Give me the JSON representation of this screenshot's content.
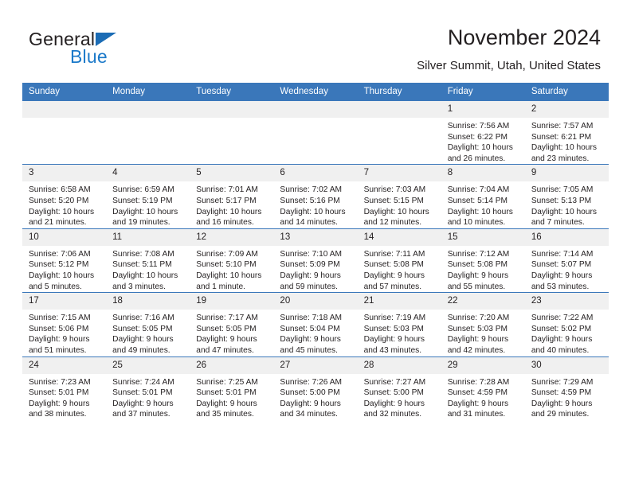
{
  "brand": {
    "name_part1": "General",
    "name_part2": "Blue"
  },
  "header": {
    "title": "November 2024",
    "subtitle": "Silver Summit, Utah, United States"
  },
  "calendar": {
    "weekday_headers": [
      "Sunday",
      "Monday",
      "Tuesday",
      "Wednesday",
      "Thursday",
      "Friday",
      "Saturday"
    ],
    "accent_color": "#3a77ba",
    "daynum_background": "#f0f0f0",
    "weeks": [
      [
        {
          "day": "",
          "empty": true
        },
        {
          "day": "",
          "empty": true
        },
        {
          "day": "",
          "empty": true
        },
        {
          "day": "",
          "empty": true
        },
        {
          "day": "",
          "empty": true
        },
        {
          "day": "1",
          "sunrise": "Sunrise: 7:56 AM",
          "sunset": "Sunset: 6:22 PM",
          "daylight": "Daylight: 10 hours and 26 minutes."
        },
        {
          "day": "2",
          "sunrise": "Sunrise: 7:57 AM",
          "sunset": "Sunset: 6:21 PM",
          "daylight": "Daylight: 10 hours and 23 minutes."
        }
      ],
      [
        {
          "day": "3",
          "sunrise": "Sunrise: 6:58 AM",
          "sunset": "Sunset: 5:20 PM",
          "daylight": "Daylight: 10 hours and 21 minutes."
        },
        {
          "day": "4",
          "sunrise": "Sunrise: 6:59 AM",
          "sunset": "Sunset: 5:19 PM",
          "daylight": "Daylight: 10 hours and 19 minutes."
        },
        {
          "day": "5",
          "sunrise": "Sunrise: 7:01 AM",
          "sunset": "Sunset: 5:17 PM",
          "daylight": "Daylight: 10 hours and 16 minutes."
        },
        {
          "day": "6",
          "sunrise": "Sunrise: 7:02 AM",
          "sunset": "Sunset: 5:16 PM",
          "daylight": "Daylight: 10 hours and 14 minutes."
        },
        {
          "day": "7",
          "sunrise": "Sunrise: 7:03 AM",
          "sunset": "Sunset: 5:15 PM",
          "daylight": "Daylight: 10 hours and 12 minutes."
        },
        {
          "day": "8",
          "sunrise": "Sunrise: 7:04 AM",
          "sunset": "Sunset: 5:14 PM",
          "daylight": "Daylight: 10 hours and 10 minutes."
        },
        {
          "day": "9",
          "sunrise": "Sunrise: 7:05 AM",
          "sunset": "Sunset: 5:13 PM",
          "daylight": "Daylight: 10 hours and 7 minutes."
        }
      ],
      [
        {
          "day": "10",
          "sunrise": "Sunrise: 7:06 AM",
          "sunset": "Sunset: 5:12 PM",
          "daylight": "Daylight: 10 hours and 5 minutes."
        },
        {
          "day": "11",
          "sunrise": "Sunrise: 7:08 AM",
          "sunset": "Sunset: 5:11 PM",
          "daylight": "Daylight: 10 hours and 3 minutes."
        },
        {
          "day": "12",
          "sunrise": "Sunrise: 7:09 AM",
          "sunset": "Sunset: 5:10 PM",
          "daylight": "Daylight: 10 hours and 1 minute."
        },
        {
          "day": "13",
          "sunrise": "Sunrise: 7:10 AM",
          "sunset": "Sunset: 5:09 PM",
          "daylight": "Daylight: 9 hours and 59 minutes."
        },
        {
          "day": "14",
          "sunrise": "Sunrise: 7:11 AM",
          "sunset": "Sunset: 5:08 PM",
          "daylight": "Daylight: 9 hours and 57 minutes."
        },
        {
          "day": "15",
          "sunrise": "Sunrise: 7:12 AM",
          "sunset": "Sunset: 5:08 PM",
          "daylight": "Daylight: 9 hours and 55 minutes."
        },
        {
          "day": "16",
          "sunrise": "Sunrise: 7:14 AM",
          "sunset": "Sunset: 5:07 PM",
          "daylight": "Daylight: 9 hours and 53 minutes."
        }
      ],
      [
        {
          "day": "17",
          "sunrise": "Sunrise: 7:15 AM",
          "sunset": "Sunset: 5:06 PM",
          "daylight": "Daylight: 9 hours and 51 minutes."
        },
        {
          "day": "18",
          "sunrise": "Sunrise: 7:16 AM",
          "sunset": "Sunset: 5:05 PM",
          "daylight": "Daylight: 9 hours and 49 minutes."
        },
        {
          "day": "19",
          "sunrise": "Sunrise: 7:17 AM",
          "sunset": "Sunset: 5:05 PM",
          "daylight": "Daylight: 9 hours and 47 minutes."
        },
        {
          "day": "20",
          "sunrise": "Sunrise: 7:18 AM",
          "sunset": "Sunset: 5:04 PM",
          "daylight": "Daylight: 9 hours and 45 minutes."
        },
        {
          "day": "21",
          "sunrise": "Sunrise: 7:19 AM",
          "sunset": "Sunset: 5:03 PM",
          "daylight": "Daylight: 9 hours and 43 minutes."
        },
        {
          "day": "22",
          "sunrise": "Sunrise: 7:20 AM",
          "sunset": "Sunset: 5:03 PM",
          "daylight": "Daylight: 9 hours and 42 minutes."
        },
        {
          "day": "23",
          "sunrise": "Sunrise: 7:22 AM",
          "sunset": "Sunset: 5:02 PM",
          "daylight": "Daylight: 9 hours and 40 minutes."
        }
      ],
      [
        {
          "day": "24",
          "sunrise": "Sunrise: 7:23 AM",
          "sunset": "Sunset: 5:01 PM",
          "daylight": "Daylight: 9 hours and 38 minutes."
        },
        {
          "day": "25",
          "sunrise": "Sunrise: 7:24 AM",
          "sunset": "Sunset: 5:01 PM",
          "daylight": "Daylight: 9 hours and 37 minutes."
        },
        {
          "day": "26",
          "sunrise": "Sunrise: 7:25 AM",
          "sunset": "Sunset: 5:01 PM",
          "daylight": "Daylight: 9 hours and 35 minutes."
        },
        {
          "day": "27",
          "sunrise": "Sunrise: 7:26 AM",
          "sunset": "Sunset: 5:00 PM",
          "daylight": "Daylight: 9 hours and 34 minutes."
        },
        {
          "day": "28",
          "sunrise": "Sunrise: 7:27 AM",
          "sunset": "Sunset: 5:00 PM",
          "daylight": "Daylight: 9 hours and 32 minutes."
        },
        {
          "day": "29",
          "sunrise": "Sunrise: 7:28 AM",
          "sunset": "Sunset: 4:59 PM",
          "daylight": "Daylight: 9 hours and 31 minutes."
        },
        {
          "day": "30",
          "sunrise": "Sunrise: 7:29 AM",
          "sunset": "Sunset: 4:59 PM",
          "daylight": "Daylight: 9 hours and 29 minutes."
        }
      ]
    ]
  }
}
